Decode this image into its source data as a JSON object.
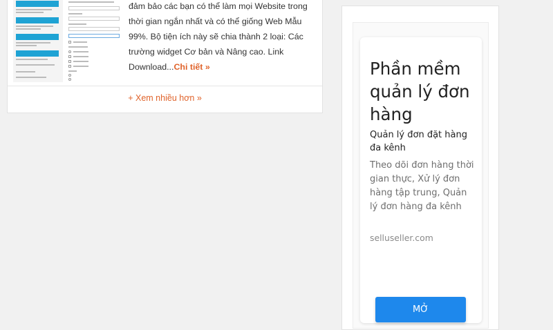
{
  "post": {
    "excerpt": "đảm bảo các bạn có thể làm mọi Website trong thời gian ngắn nhất và có thể giống Web Mẫu 99%. Bộ tiện ích này sẽ chia thành 2 loại: Các trường widget Cơ bản và Nâng cao. Link Download...",
    "read_more": "Chi tiết »"
  },
  "more_link": "+ Xem nhiều hơn »",
  "ad": {
    "choices_icons": [
      "info-icon",
      "close-icon"
    ],
    "title": "Phần mềm quản lý đơn hàng",
    "subtitle": "Quản lý đơn đặt hàng đa kênh",
    "description": "Theo dõi đơn hàng thời gian thực, Xử lý đơn hàng tập trung, Quản lý đơn hàng đa kênh",
    "domain": "selluseller.com",
    "button_label": "MỞ",
    "button_color": "#1e88ec"
  },
  "colors": {
    "accent": "#e0632b",
    "thumb_blue": "#1fa3d4",
    "ad_link": "#3c8ee8"
  }
}
